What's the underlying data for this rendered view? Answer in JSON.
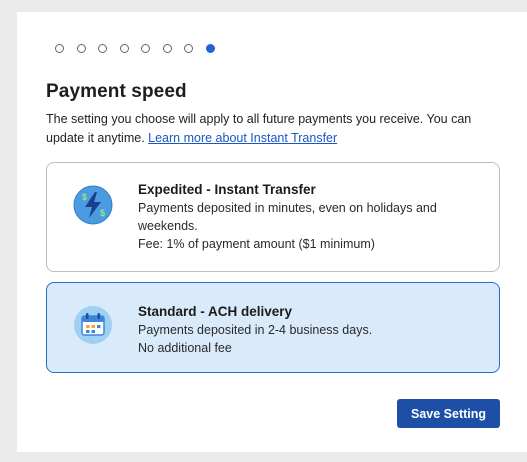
{
  "stepper": {
    "total_steps": 8,
    "current_step": 8
  },
  "page": {
    "title": "Payment speed",
    "description": "The setting you choose will apply to all future payments you receive. You can update it anytime. ",
    "learn_more_link": "Learn more about Instant Transfer"
  },
  "options": [
    {
      "id": "expedited",
      "title": "Expedited - Instant Transfer",
      "lines": [
        "Payments deposited in minutes, even on holidays and weekends.",
        "Fee: 1% of payment amount ($1 minimum)"
      ],
      "icon": "lightning-dollar-icon",
      "selected": false
    },
    {
      "id": "standard",
      "title": "Standard - ACH delivery",
      "lines": [
        "Payments deposited in 2-4 business days.",
        "No additional fee"
      ],
      "icon": "calendar-icon",
      "selected": true
    }
  ],
  "actions": {
    "save_label": "Save Setting"
  },
  "colors": {
    "accent": "#1f63d6",
    "button": "#1e4fa7",
    "selected_bg": "#d9ebfb",
    "selected_border": "#2a6bd1",
    "link": "#1a56c4"
  }
}
